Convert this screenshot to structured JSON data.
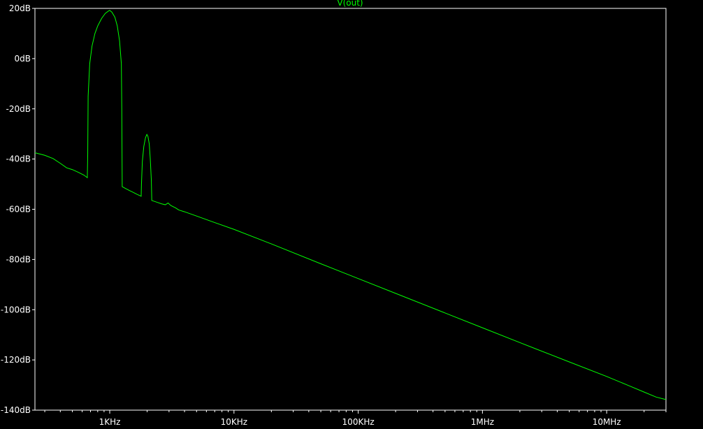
{
  "colors": {
    "background": "#000000",
    "axis": "#ffffff",
    "text": "#ffffff",
    "trace": "#00ff00"
  },
  "chart_data": {
    "type": "line",
    "title": "V(out)",
    "xscale": "log",
    "xlim": [
      250,
      30000000
    ],
    "ylim": [
      -140,
      20
    ],
    "grid": false,
    "xunit": "Hz",
    "yunit": "dB",
    "xticks": [
      {
        "value": 1000,
        "label": "1KHz"
      },
      {
        "value": 10000,
        "label": "10KHz"
      },
      {
        "value": 100000,
        "label": "100KHz"
      },
      {
        "value": 1000000,
        "label": "1MHz"
      },
      {
        "value": 10000000,
        "label": "10MHz"
      }
    ],
    "yticks": [
      {
        "value": 20,
        "label": "20dB"
      },
      {
        "value": 0,
        "label": "0dB"
      },
      {
        "value": -20,
        "label": "-20dB"
      },
      {
        "value": -40,
        "label": "-40dB"
      },
      {
        "value": -60,
        "label": "-60dB"
      },
      {
        "value": -80,
        "label": "-80dB"
      },
      {
        "value": -100,
        "label": "-100dB"
      },
      {
        "value": -120,
        "label": "-120dB"
      },
      {
        "value": -140,
        "label": "-140dB"
      }
    ],
    "series": [
      {
        "name": "V(out)",
        "color": "#00ff00",
        "points": [
          [
            250,
            -37.5
          ],
          [
            300,
            -38.5
          ],
          [
            350,
            -39.8
          ],
          [
            400,
            -41.7
          ],
          [
            450,
            -43.5
          ],
          [
            500,
            -44.2
          ],
          [
            560,
            -45.3
          ],
          [
            620,
            -46.4
          ],
          [
            660,
            -47.4
          ],
          [
            665,
            -38
          ],
          [
            670,
            -15
          ],
          [
            690,
            -2
          ],
          [
            720,
            5
          ],
          [
            760,
            10
          ],
          [
            800,
            13
          ],
          [
            860,
            16
          ],
          [
            920,
            18
          ],
          [
            980,
            19
          ],
          [
            1000,
            19.2
          ],
          [
            1040,
            18.5
          ],
          [
            1100,
            16.5
          ],
          [
            1150,
            13
          ],
          [
            1200,
            7
          ],
          [
            1240,
            -2
          ],
          [
            1250,
            -20
          ],
          [
            1260,
            -51
          ],
          [
            1350,
            -51.8
          ],
          [
            1450,
            -52.6
          ],
          [
            1550,
            -53.3
          ],
          [
            1650,
            -54
          ],
          [
            1790,
            -54.8
          ],
          [
            1800,
            -50
          ],
          [
            1830,
            -41
          ],
          [
            1880,
            -35
          ],
          [
            1940,
            -31.5
          ],
          [
            1990,
            -30.2
          ],
          [
            2030,
            -31
          ],
          [
            2080,
            -34
          ],
          [
            2120,
            -40
          ],
          [
            2160,
            -48
          ],
          [
            2180,
            -56.5
          ],
          [
            2400,
            -57.2
          ],
          [
            2600,
            -57.8
          ],
          [
            2800,
            -58.2
          ],
          [
            2950,
            -57.5
          ],
          [
            3100,
            -58.5
          ],
          [
            3400,
            -59.5
          ],
          [
            3600,
            -60.3
          ],
          [
            4000,
            -61
          ],
          [
            5000,
            -62.7
          ],
          [
            7000,
            -65.3
          ],
          [
            10000,
            -68
          ],
          [
            20000,
            -73.8
          ],
          [
            50000,
            -81.7
          ],
          [
            100000,
            -87.6
          ],
          [
            200000,
            -93.5
          ],
          [
            500000,
            -101.3
          ],
          [
            1000000,
            -107.2
          ],
          [
            2000000,
            -113.1
          ],
          [
            5000000,
            -120.8
          ],
          [
            10000000,
            -126.6
          ],
          [
            15000000,
            -130.2
          ],
          [
            20000000,
            -132.8
          ],
          [
            25000000,
            -134.8
          ],
          [
            30000000,
            -135.8
          ]
        ]
      }
    ]
  }
}
